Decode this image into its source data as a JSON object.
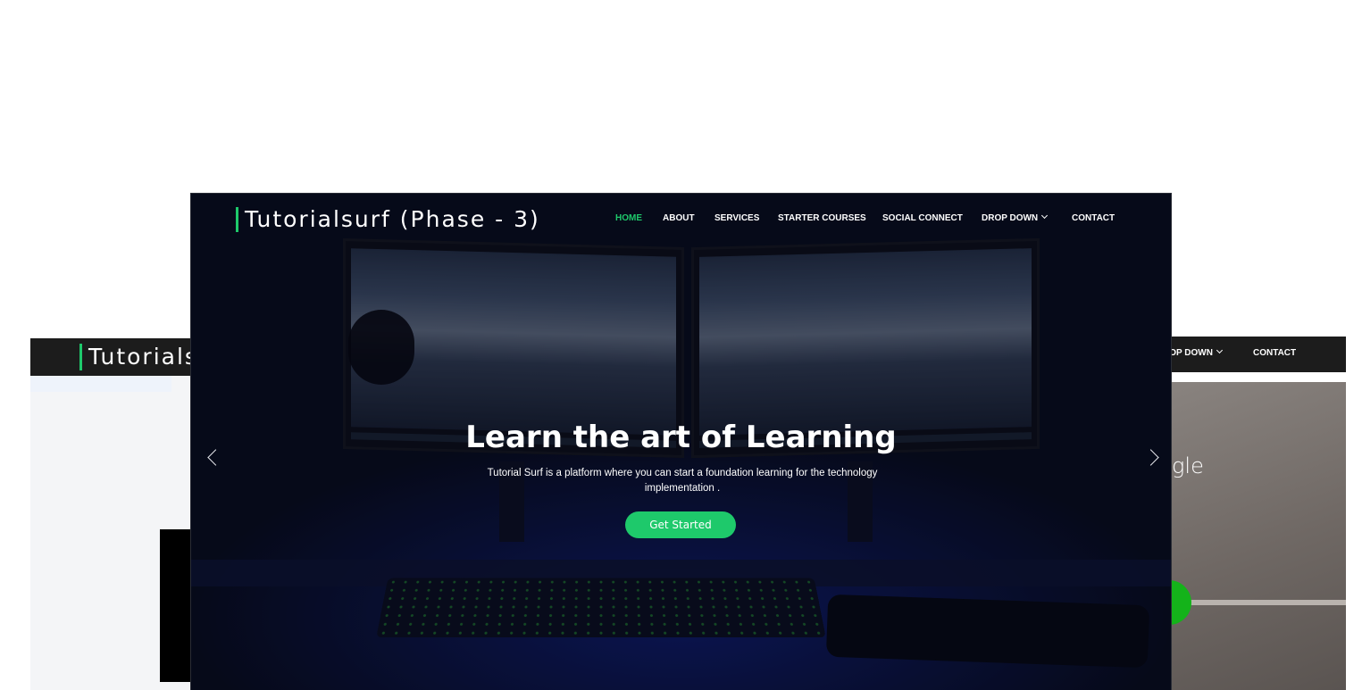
{
  "background_cards": {
    "left": {
      "brand": "Tutorials"
    },
    "right": {
      "nav_dropdown": "ROP DOWN",
      "nav_contact": "CONTACT",
      "partial_text": "gle"
    }
  },
  "hero": {
    "logo": "Tutorialsurf (Phase - 3)",
    "nav": [
      {
        "label": "HOME",
        "active": true
      },
      {
        "label": "ABOUT"
      },
      {
        "label": "SERVICES"
      },
      {
        "label": "STARTER COURSES"
      },
      {
        "label": "SOCIAL CONNECT"
      },
      {
        "label": "DROP DOWN",
        "has_dropdown": true
      },
      {
        "label": "CONTACT"
      }
    ],
    "title": "Learn the art of Learning",
    "subtitle": "Tutorial Surf is a platform where you can start a foundation learning for the technology implementation .",
    "cta_label": "Get Started",
    "prev_icon": "chevron-left-icon",
    "next_icon": "chevron-right-icon"
  },
  "colors": {
    "accent_green": "#1ec96b",
    "nav_bar": "#1c1c1c",
    "hero_dark": "#070b1a"
  }
}
